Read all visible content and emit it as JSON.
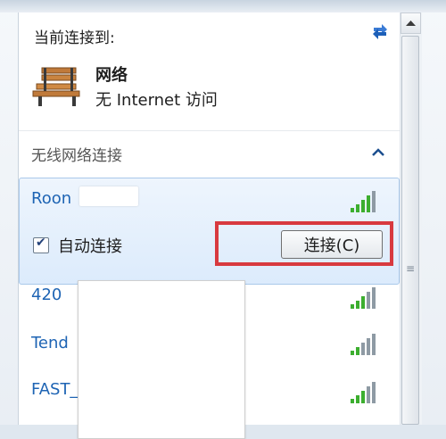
{
  "header": {
    "title": "当前连接到:"
  },
  "current_network": {
    "name": "网络",
    "status": "无 Internet 访问"
  },
  "section": {
    "title": "无线网络连接"
  },
  "networks": [
    {
      "ssid": "Roon",
      "signal": "excellent",
      "selected": true
    },
    {
      "ssid": "420",
      "signal": "excellent"
    },
    {
      "ssid": "Tend",
      "signal": "good"
    },
    {
      "ssid": "FAST_",
      "signal": "excellent"
    }
  ],
  "selected_item": {
    "autoconnect_label": "自动连接",
    "autoconnect_checked": true,
    "connect_button_label": "连接(C)"
  },
  "colors": {
    "link_blue": "#1e64b4",
    "signal_green": "#3cae2f",
    "highlight_red": "#d83a3f"
  }
}
